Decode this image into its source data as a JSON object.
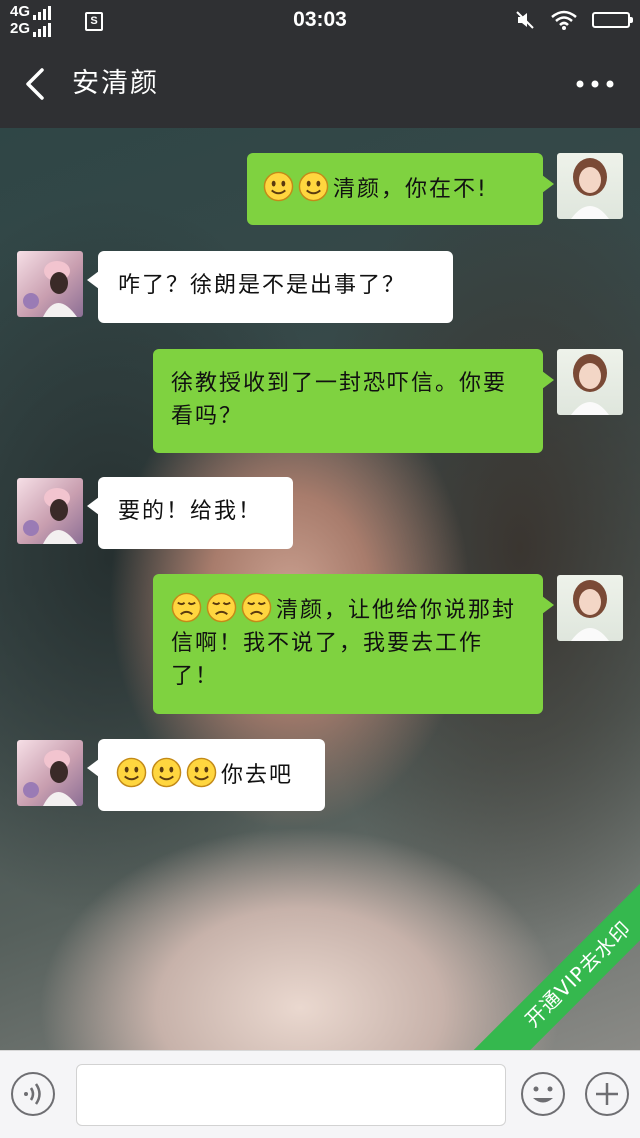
{
  "status_bar": {
    "network_top": "4G",
    "network_bottom": "2G",
    "sim_label": "S",
    "time": "03:03"
  },
  "header": {
    "title": "安清颜"
  },
  "messages": [
    {
      "side": "right",
      "text": "清颜，你在不!",
      "emojis": [
        "smile-emoji",
        "smile-emoji"
      ]
    },
    {
      "side": "left",
      "text": "咋了？徐朗是不是出事了？",
      "emojis": []
    },
    {
      "side": "right",
      "text": "徐教授收到了一封恐吓信。你要看吗？",
      "emojis": []
    },
    {
      "side": "left",
      "text": "要的！给我！",
      "emojis": []
    },
    {
      "side": "right",
      "text": "清颜，让他给你说那封信啊！我不说了，我要去工作了！",
      "emojis": [
        "sad-emoji",
        "sad-emoji",
        "sad-emoji"
      ]
    },
    {
      "side": "left",
      "text": "你去吧",
      "emojis": [
        "smile-emoji",
        "smile-emoji",
        "smile-emoji"
      ]
    }
  ],
  "watermark": {
    "text": "开通VIP去水印"
  },
  "input_bar": {
    "field_value": ""
  },
  "colors": {
    "bar_background": "#2f3033",
    "bubble_sent": "#7fd240",
    "bubble_received": "#ffffff",
    "watermark_green": "#35b84e"
  }
}
